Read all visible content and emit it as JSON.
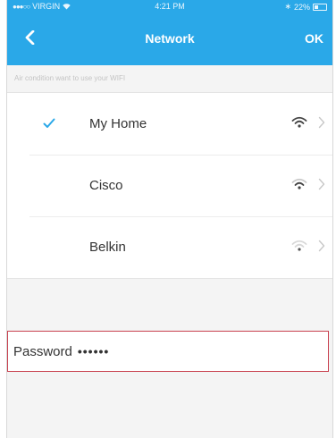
{
  "status_bar": {
    "carrier": "VIRGIN",
    "time": "4:21 PM",
    "battery": "22%"
  },
  "navbar": {
    "title": "Network",
    "ok_label": "OK"
  },
  "hint": "Air condition want to use your WIFI",
  "networks": [
    {
      "name": "My Home",
      "selected": true,
      "signal": "strong"
    },
    {
      "name": "Cisco",
      "selected": false,
      "signal": "medium"
    },
    {
      "name": "Belkin",
      "selected": false,
      "signal": "weak"
    }
  ],
  "password": {
    "label": "Password",
    "value": "••••••"
  },
  "colors": {
    "accent": "#2aa8e8",
    "highlight_border": "#c8414f"
  }
}
